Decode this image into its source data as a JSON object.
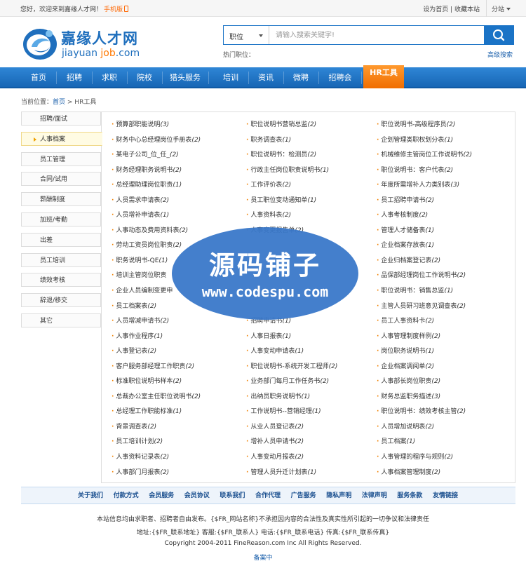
{
  "topbar": {
    "welcome": "您好，欢迎来到嘉缘人才网！",
    "mobile": "手机版",
    "links": "设为首页 | 收藏本站",
    "substation": "分站"
  },
  "logo": {
    "cn": "嘉缘人才网",
    "en_a": "jiayuan",
    "en_b": "job",
    "en_c": ".com"
  },
  "search": {
    "category": "职位",
    "placeholder": "请输入搜索关键字!",
    "hot_label": "热门职位：",
    "advanced": "高级搜索"
  },
  "nav": [
    "首页",
    "招聘",
    "求职",
    "院校",
    "猎头服务",
    "培训",
    "资讯",
    "微聘",
    "招聘会",
    "HR工具"
  ],
  "breadcrumb": {
    "prefix": "当前位置：",
    "home": "首页",
    "sep": " > ",
    "current": "HR工具"
  },
  "sidebar": [
    "招聘/面试",
    "人事档案",
    "员工管理",
    "合同/试用",
    "薪酬制度",
    "加班/考勤",
    "出差",
    "员工培训",
    "绩效考核",
    "辞退/移交",
    "其它"
  ],
  "sidebar_active": 1,
  "columns": [
    [
      {
        "t": "预算部职能说明",
        "c": "(3)"
      },
      {
        "t": "财务中心总经理岗位手册表",
        "c": "(2)"
      },
      {
        "t": "某电子公司_位_任_",
        "c": "(2)"
      },
      {
        "t": "财务经理职务说明书",
        "c": "(2)"
      },
      {
        "t": "总经理助理岗位职责",
        "c": "(1)"
      },
      {
        "t": "人员需求申请表",
        "c": "(2)"
      },
      {
        "t": "人员增补申请表",
        "c": "(1)"
      },
      {
        "t": "人事动态及费用资料表",
        "c": "(2)"
      },
      {
        "t": "劳动工资员岗位职责",
        "c": "(2)"
      },
      {
        "t": "职务说明书-QE",
        "c": "(1)"
      },
      {
        "t": "培训主管岗位职责",
        "c": ""
      },
      {
        "t": "企业人员编制变更申",
        "c": ""
      },
      {
        "t": "员工档案表",
        "c": "(2)"
      },
      {
        "t": "人员增减申请书",
        "c": "(2)"
      },
      {
        "t": "人事作业程序",
        "c": "(1)"
      },
      {
        "t": "人事登记表",
        "c": "(2)"
      },
      {
        "t": "客户服务部经理工作职责",
        "c": "(2)"
      },
      {
        "t": "标准职位说明书样本",
        "c": "(2)"
      },
      {
        "t": "总裁办公室主任职位说明书",
        "c": "(2)"
      },
      {
        "t": "总经理工作职能标准",
        "c": "(1)"
      },
      {
        "t": "背景调查表",
        "c": "(2)"
      },
      {
        "t": "员工培训计划",
        "c": "(2)"
      },
      {
        "t": "人事资料记录表",
        "c": "(2)"
      },
      {
        "t": "人事部门月报表",
        "c": "(2)"
      }
    ],
    [
      {
        "t": "职位说明书营销总监",
        "c": "(2)"
      },
      {
        "t": "职务调查表",
        "c": "(1)"
      },
      {
        "t": "职位说明书：检测员",
        "c": "(2)"
      },
      {
        "t": "行政主任岗位职责说明书",
        "c": "(1)"
      },
      {
        "t": "工作评价表",
        "c": "(2)"
      },
      {
        "t": "员工职位变动通知单",
        "c": "(1)"
      },
      {
        "t": "人事资料表",
        "c": "(2)"
      },
      {
        "t": "人事变更报告单",
        "c": "(2)"
      },
      {
        "t": "",
        "c": ""
      },
      {
        "t": "",
        "c": ""
      },
      {
        "t": "",
        "c": ""
      },
      {
        "t": "",
        "c": ""
      },
      {
        "t": "",
        "c": ""
      },
      {
        "t": "招聘申请书",
        "c": "(1)"
      },
      {
        "t": "人事日报表",
        "c": "(1)"
      },
      {
        "t": "人事变动申请表",
        "c": "(1)"
      },
      {
        "t": "职位说明书-系统开发工程师",
        "c": "(2)"
      },
      {
        "t": "业务部门每月工作任务书",
        "c": "(2)"
      },
      {
        "t": "出纳员职务说明书",
        "c": "(1)"
      },
      {
        "t": "工作说明书--营销经理",
        "c": "(1)"
      },
      {
        "t": "从业人员登记表",
        "c": "(2)"
      },
      {
        "t": "增补人员申请书",
        "c": "(2)"
      },
      {
        "t": "人事变动月报表",
        "c": "(2)"
      },
      {
        "t": "管理人员升迁计划表",
        "c": "(1)"
      }
    ],
    [
      {
        "t": "职位说明书-高级程序员",
        "c": "(2)"
      },
      {
        "t": "企划管理类职权划分表",
        "c": "(1)"
      },
      {
        "t": "机械维修主管岗位工作说明书",
        "c": "(2)"
      },
      {
        "t": "职位说明书：客户代表",
        "c": "(2)"
      },
      {
        "t": "年度所需增补人力类别表",
        "c": "(3)"
      },
      {
        "t": "员工招聘申请书",
        "c": "(2)"
      },
      {
        "t": "人事考核制度",
        "c": "(2)"
      },
      {
        "t": "管理人才储备表",
        "c": "(1)"
      },
      {
        "t": "企业档案存放表",
        "c": "(1)"
      },
      {
        "t": "企业归档案登记表",
        "c": "(2)"
      },
      {
        "t": "品保部经理岗位工作说明书",
        "c": "(2)"
      },
      {
        "t": "职位说明书：销售总监",
        "c": "(1)"
      },
      {
        "t": "主管人员研习班意见调查表",
        "c": "(2)"
      },
      {
        "t": "员工人事资料卡",
        "c": "(2)"
      },
      {
        "t": "人事管理制度样例",
        "c": "(2)"
      },
      {
        "t": "岗位职务说明书",
        "c": "(1)"
      },
      {
        "t": "企业档案调阅单",
        "c": "(2)"
      },
      {
        "t": "人事部长岗位职责",
        "c": "(2)"
      },
      {
        "t": "财务总监职务描述",
        "c": "(3)"
      },
      {
        "t": "职位说明书：绩效考核主管",
        "c": "(2)"
      },
      {
        "t": "人员增加说明表",
        "c": "(2)"
      },
      {
        "t": "员工档案",
        "c": "(1)"
      },
      {
        "t": "人事管理的程序与规则",
        "c": "(2)"
      },
      {
        "t": "人事档案管理制度",
        "c": "(2)"
      }
    ]
  ],
  "watermark": {
    "line1": "源码铺子",
    "line2": "www.codespu.com"
  },
  "footer_nav": [
    "关于我们",
    "付款方式",
    "会员服务",
    "会员协议",
    "联系我们",
    "合作代理",
    "广告服务",
    "隐私声明",
    "法律声明",
    "服务条款",
    "友情链接"
  ],
  "footer": {
    "line1": "本站信息均由求职者、招聘者自由发布。{$FR_网站名称}不承担因内容的合法性及真实性所引起的一切争议和法律责任",
    "line2": "地址:{$FR_联系地址} 客服:{$FR_联系人} 电话:{$FR_联系电话} 传真:{$FR_联系传真}",
    "line3": "Copyright 2004-2011 FineReason.com Inc All Rights Reserved.",
    "icp": "备案中"
  },
  "colors": {
    "brand": "#1a73c6",
    "accent": "#f07a00"
  }
}
